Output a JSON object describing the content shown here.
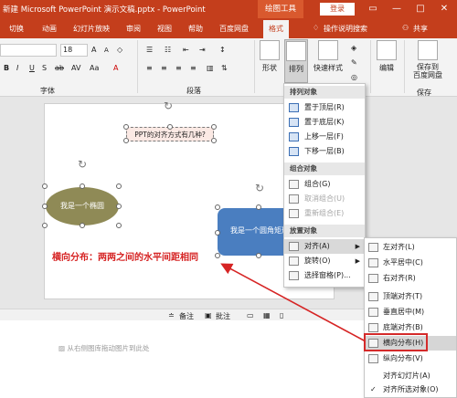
{
  "title": "新建 Microsoft PowerPoint 演示文稿.pptx  -  PowerPoint",
  "drawing_tools": "绘图工具",
  "login": "登录",
  "window": {
    "min": "—",
    "max": "□",
    "close": "✕"
  },
  "tabs": [
    "切换",
    "动画",
    "幻灯片放映",
    "审阅",
    "视图",
    "帮助",
    "百度网盘",
    "格式"
  ],
  "tell_me": "操作说明搜索",
  "share": "共享",
  "ribbon": {
    "font_size": "18",
    "font_group": "字体",
    "paragraph_group": "段落",
    "shape": "形状",
    "arrange": "排列",
    "quick_styles": "快速样式",
    "edit": "编辑",
    "save_to": "保存到",
    "baidu_disk": "百度网盘",
    "save_label": "保存"
  },
  "arrange_menu": {
    "header_order": "排列对象",
    "bring_front": "置于顶层(R)",
    "send_back": "置于底层(K)",
    "bring_forward": "上移一层(F)",
    "send_backward": "下移一层(B)",
    "header_group": "组合对象",
    "group": "组合(G)",
    "ungroup": "取消组合(U)",
    "regroup": "重新组合(E)",
    "header_position": "放置对象",
    "align": "对齐(A)",
    "rotate": "旋转(O)",
    "selection_pane": "选择窗格(P)..."
  },
  "align_menu": {
    "left": "左对齐(L)",
    "center": "水平居中(C)",
    "right": "右对齐(R)",
    "top": "顶端对齐(T)",
    "middle": "垂直居中(M)",
    "bottom": "底端对齐(B)",
    "distribute_h": "横向分布(H)",
    "distribute_v": "纵向分布(V)",
    "align_slide": "对齐幻灯片(A)",
    "align_selected": "对齐所选对象(O)"
  },
  "slide": {
    "text_box": "PPT的对齐方式有几种?",
    "ellipse": "我是一个椭圆",
    "rounded_rect": "我是一个圆角矩形",
    "annotation": "横向分布：两两之间的水平间距相同"
  },
  "status": {
    "notes": "备注",
    "comments": "批注"
  },
  "notes_hint": "从右侧图库拖动图片到此处",
  "colors": {
    "accent": "#c43e1c",
    "ellipse": "#8f8a56",
    "rect": "#4a7ec0",
    "annotation": "#d62424"
  }
}
